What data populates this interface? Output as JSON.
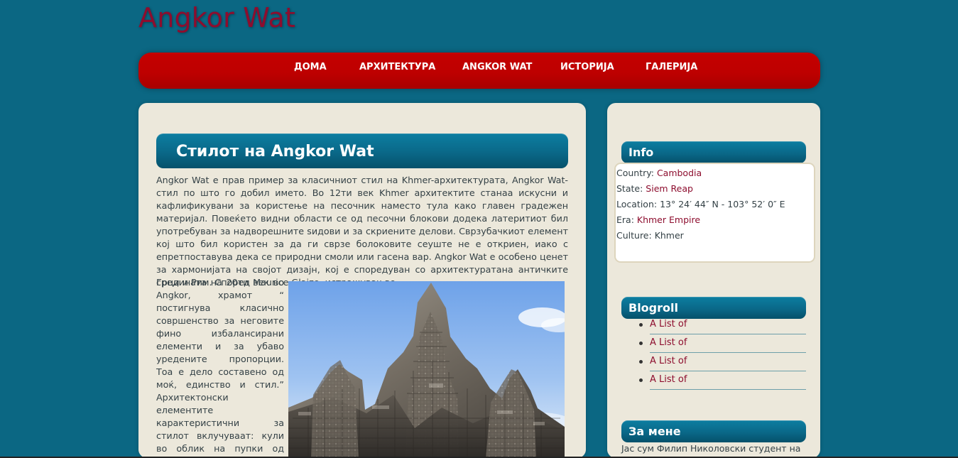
{
  "site": {
    "title": "Angkor Wat"
  },
  "nav": {
    "items": [
      {
        "label": "ДОМА"
      },
      {
        "label": "АРХИТЕКТУРА"
      },
      {
        "label": "ANGKOR WAT"
      },
      {
        "label": "ИСТОРИЈА"
      },
      {
        "label": "ГАЛЕРИЈА"
      }
    ]
  },
  "main": {
    "title": "Стилот на Angkor Wat",
    "intro_text": "Angkor Wat е прав пример за класичниот стил на Khmer-архитектурата, Angkor Wat-стил по што го добил името. Во 12ти век Khmer архитектите станаа искусни и кафлификувани за користење на песочник наместо тула како главен градежен материјал. Повеќето видни области се од песочни блокови додека латеритиот бил употребуван за надворешните ѕидови и за скриените делови. Сврзубачкиот елемент кој што бил користен за да ги сврзе болоковите сеуште не е откриен, иако с епретпоставува дека се природни смоли или гасена вар. Angkor Wat е особено ценет за хармонијата на својот дизајн, кој е споредуван со архитектуратана античките Грци и Рим. Според Maurice Glaize, истражувач во",
    "side_text": "средината на 20ти век во Angkor, храмот “ постигнува класично совршенство за неговите фино избалансирани елементи и за убаво уредените пропорции. Тоа е дело составено од моќ, единство и стил.” Архитектонски елементите карактеристични за стилот вклучуваат: кули во облик на пупки од лотос, пола галерии за пошироки"
  },
  "info": {
    "title": "Info",
    "rows": [
      {
        "label": "Country: ",
        "value": "Cambodia"
      },
      {
        "label": "State: ",
        "value": "Siem Reap"
      },
      {
        "label": "Location: ",
        "value": "13° 24′ 44″ N - 103° 52′ 0″ E"
      },
      {
        "label": "Era: ",
        "value": "Khmer Empire"
      },
      {
        "label": "Culture: ",
        "value": "Khmer"
      }
    ]
  },
  "blogroll": {
    "title": "Blogroll",
    "items": [
      {
        "label": "A List of"
      },
      {
        "label": "A List of"
      },
      {
        "label": "A List of"
      },
      {
        "label": "A List of"
      }
    ]
  },
  "about": {
    "title": "За мене",
    "text": "Јас сум Филип Николовски студент на"
  },
  "colors": {
    "page_background": "#0b6783",
    "nav_red": "#c40000",
    "panel_cream": "#ece8db",
    "link_color": "#8d0d2e"
  }
}
